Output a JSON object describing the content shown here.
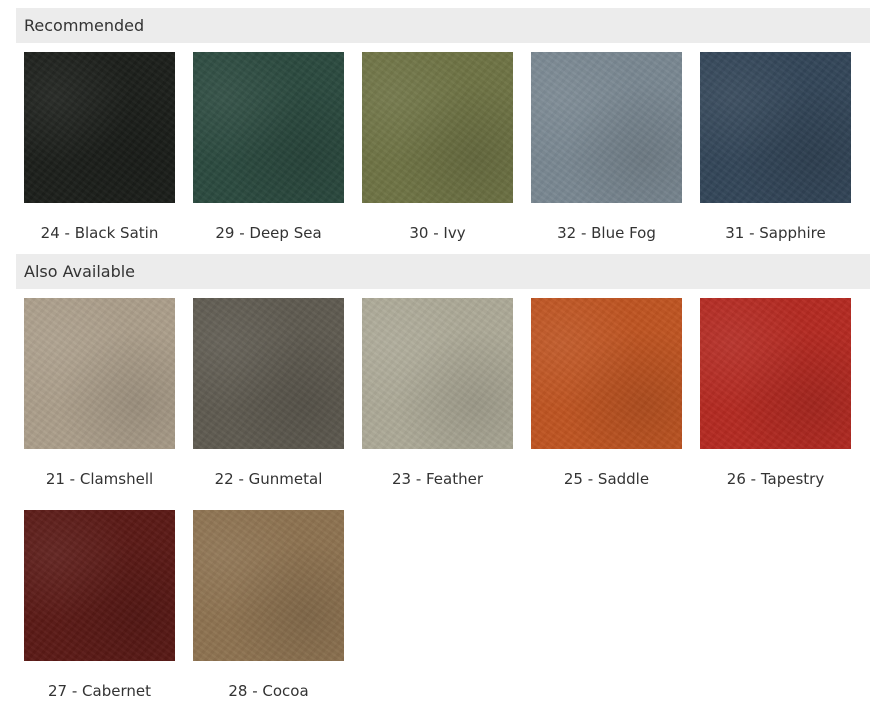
{
  "sections": [
    {
      "title": "Recommended",
      "swatches": [
        {
          "label": "24 - Black Satin",
          "color": "#1c1f1b"
        },
        {
          "label": "29 - Deep Sea",
          "color": "#2b4a3f"
        },
        {
          "label": "30 - Ivy",
          "color": "#6f7445"
        },
        {
          "label": "32 - Blue Fog",
          "color": "#7a8892"
        },
        {
          "label": "31 - Sapphire",
          "color": "#334659"
        }
      ]
    },
    {
      "title": "Also Available",
      "swatches": [
        {
          "label": "21 - Clamshell",
          "color": "#ac9f8b"
        },
        {
          "label": "22 - Gunmetal",
          "color": "#5f5b51"
        },
        {
          "label": "23 - Feather",
          "color": "#adaa98"
        },
        {
          "label": "25 - Saddle",
          "color": "#c05522"
        },
        {
          "label": "26 - Tapestry",
          "color": "#b52a22"
        },
        {
          "label": "27 - Cabernet",
          "color": "#5b1a16"
        },
        {
          "label": "28 - Cocoa",
          "color": "#8e7351"
        }
      ]
    }
  ]
}
